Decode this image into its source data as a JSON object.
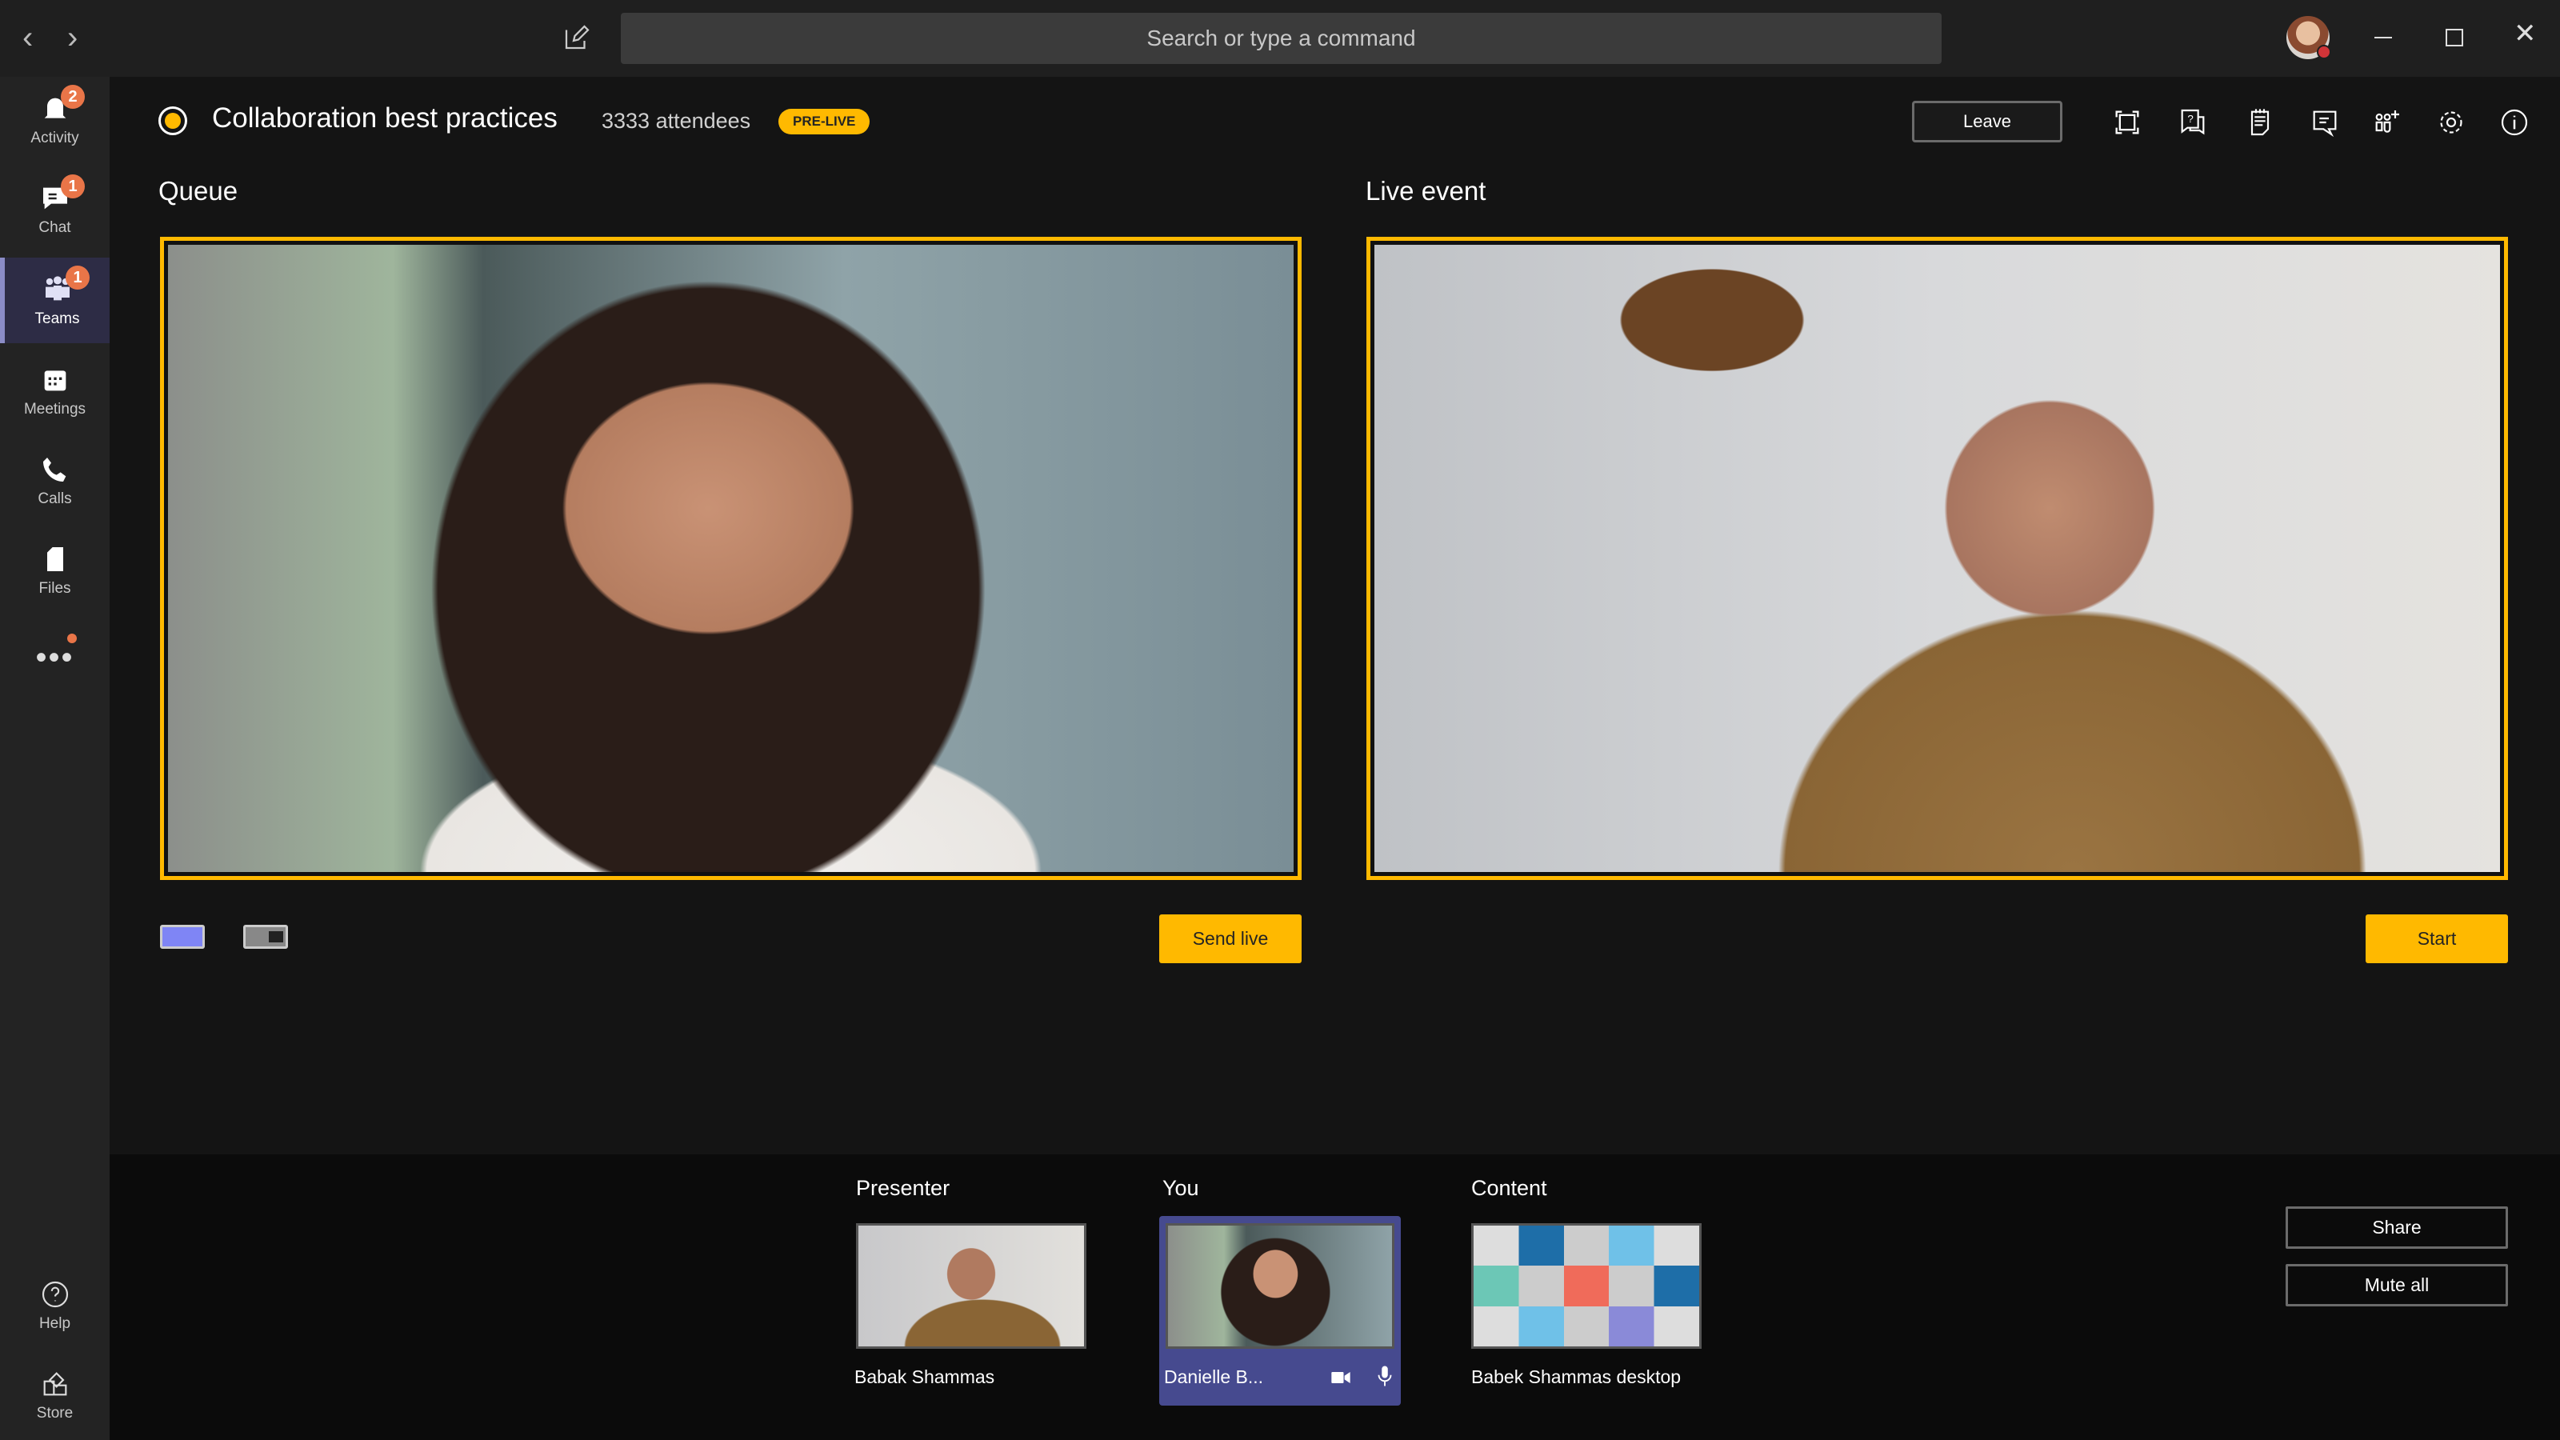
{
  "topbar": {
    "search_placeholder": "Search or type a command",
    "back_icon": "chevron-left-icon",
    "forward_icon": "chevron-right-icon",
    "compose_icon": "compose-icon"
  },
  "rail": {
    "items": [
      {
        "label": "Activity",
        "icon": "bell-icon",
        "badge": "2"
      },
      {
        "label": "Chat",
        "icon": "chat-icon",
        "badge": "1"
      },
      {
        "label": "Teams",
        "icon": "teams-icon",
        "badge": "1",
        "selected": true
      },
      {
        "label": "Meetings",
        "icon": "calendar-icon"
      },
      {
        "label": "Calls",
        "icon": "phone-icon"
      },
      {
        "label": "Files",
        "icon": "file-icon"
      }
    ],
    "more_icon": "more-icon",
    "help": {
      "label": "Help"
    },
    "store": {
      "label": "Store"
    }
  },
  "header": {
    "title": "Collaboration best practices",
    "attendees": "3333 attendees",
    "status_badge": "PRE-LIVE",
    "leave_label": "Leave",
    "icons": [
      "fullscreen-icon",
      "qna-icon",
      "notes-icon",
      "chat-icon",
      "add-people-icon",
      "gear-icon",
      "info-icon"
    ]
  },
  "queue": {
    "title": "Queue",
    "send_live_label": "Send live"
  },
  "live": {
    "title": "Live event",
    "start_label": "Start"
  },
  "bottom": {
    "presenter": {
      "label": "Presenter",
      "name": "Babak Shammas"
    },
    "you": {
      "label": "You",
      "name": "Danielle B..."
    },
    "content": {
      "label": "Content",
      "name": "Babek Shammas desktop"
    },
    "share_label": "Share",
    "mute_all_label": "Mute all"
  },
  "colors": {
    "accent": "#ffb900",
    "brand": "#464a8f",
    "badge": "#e97548"
  }
}
